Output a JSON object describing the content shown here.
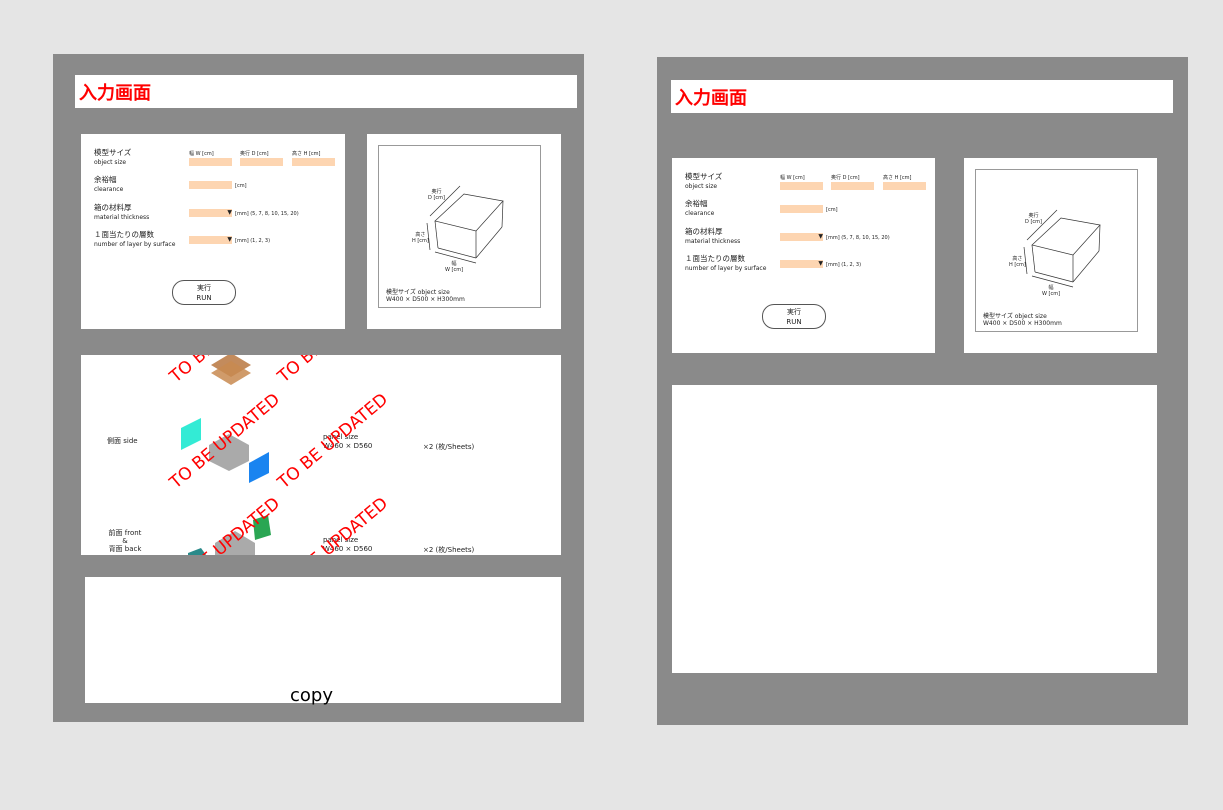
{
  "title": "入力画面",
  "form": {
    "object_size_jp": "模型サイズ",
    "object_size_en": "object size",
    "w_label": "幅 W [cm]",
    "d_label": "奥行 D [cm]",
    "h_label": "高さ H [cm]",
    "clearance_jp": "余裕幅",
    "clearance_en": "clearance",
    "clearance_unit": "[cm]",
    "thickness_jp": "箱の材料厚",
    "thickness_en": "material thickness",
    "thickness_note": "[mm]  (5, 7, 8, 10, 15, 20)",
    "layers_jp": "１面当たりの層数",
    "layers_en": "number of layer by surface",
    "layers_note": "[mm]  (1, 2, 3)",
    "dropdown_arrow": "▼",
    "run_jp": "実行",
    "run_en": "RUN"
  },
  "diagram": {
    "depth_label": "奥行",
    "depth_unit": "D [cm]",
    "height_label": "高さ",
    "height_unit": "H [cm]",
    "width_label": "幅",
    "width_unit": "W [cm]",
    "caption_1": "模型サイズ object size",
    "caption_2": "W400 × D500 × H300mm"
  },
  "results": {
    "watermark": "TO BE UPDATED",
    "rows": [
      {
        "label": "側面 side",
        "panel_label": "panel size",
        "panel_size": "W460 × D560",
        "count": "×2 (枚/Sheets)"
      },
      {
        "label_1": "前面 front",
        "label_2": "&",
        "label_3": "背面 back",
        "panel_label": "panel size",
        "panel_size": "W460 × D560",
        "count": "×2 (枚/Sheets)"
      }
    ],
    "colors": {
      "bottom": "#b8773f",
      "side_a": "#1de9d0",
      "side_b": "#1a84f0",
      "front": "#2aa653",
      "back": "#2a8a8a"
    }
  },
  "copy_label": "copy"
}
